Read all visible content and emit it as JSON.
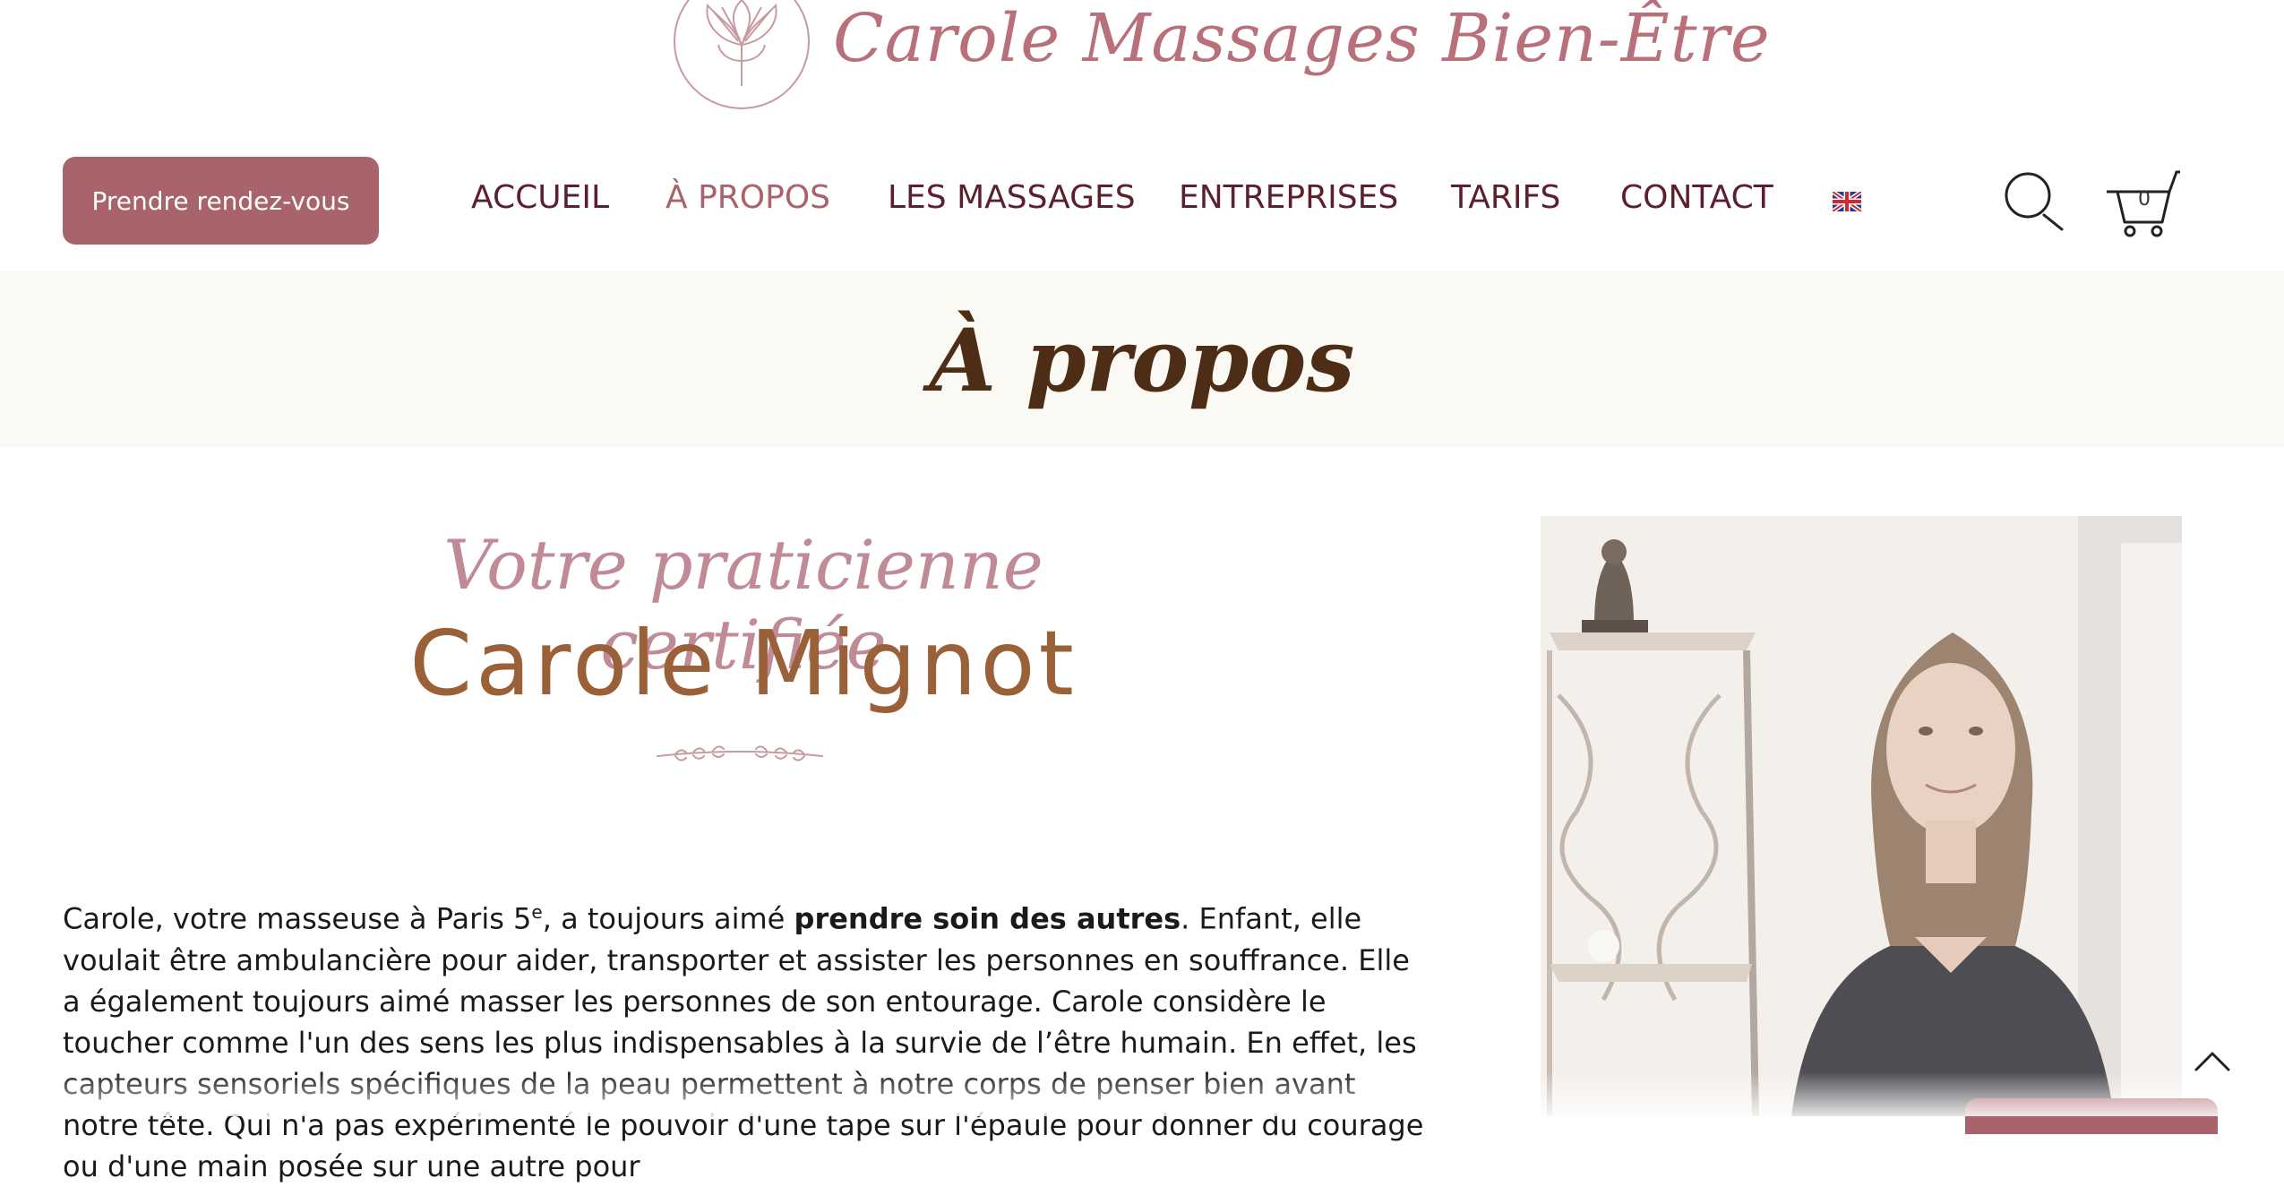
{
  "brand": {
    "name": "Carole Massages Bien-Être"
  },
  "header": {
    "cta_label": "Prendre rendez-vous",
    "nav": [
      {
        "label": "ACCUEIL",
        "active": false
      },
      {
        "label": "À PROPOS",
        "active": true
      },
      {
        "label": "LES MASSAGES",
        "active": false
      },
      {
        "label": "ENTREPRISES",
        "active": false
      },
      {
        "label": "TARIFS",
        "active": false
      },
      {
        "label": "CONTACT",
        "active": false
      }
    ],
    "language_flag": "uk-flag-icon",
    "cart_count": "0"
  },
  "page": {
    "title": "À propos"
  },
  "intro": {
    "subtitle": "Votre praticienne certifiée",
    "name": "Carole Mignot",
    "p_before_sup": "Carole, votre masseuse à Paris 5",
    "p_sup": "e",
    "p_mid": ", a toujours aimé ",
    "p_bold": "prendre soin des autres",
    "p_after": ". Enfant, elle voulait être ambulancière pour aider, transporter et assister les personnes en souffrance. Elle a également toujours aimé masser les personnes de son entourage. Carole considère le toucher comme l'un des sens les plus indispensables à la survie de l’être humain. En effet, les capteurs sensoriels spécifiques de la peau permettent à notre corps de penser bien avant notre tête. Qui n'a pas expérimenté le pouvoir d'une tape sur l'épaule pour donner du courage ou d'une main posée sur une autre pour"
  },
  "colors": {
    "accent": "#a8646a",
    "nav_text": "#5c1f2d",
    "title_brown": "#4e2d17",
    "name_brown": "#9a6038",
    "subtitle_pink": "#c08a96",
    "band_bg": "#fbf9f3"
  }
}
